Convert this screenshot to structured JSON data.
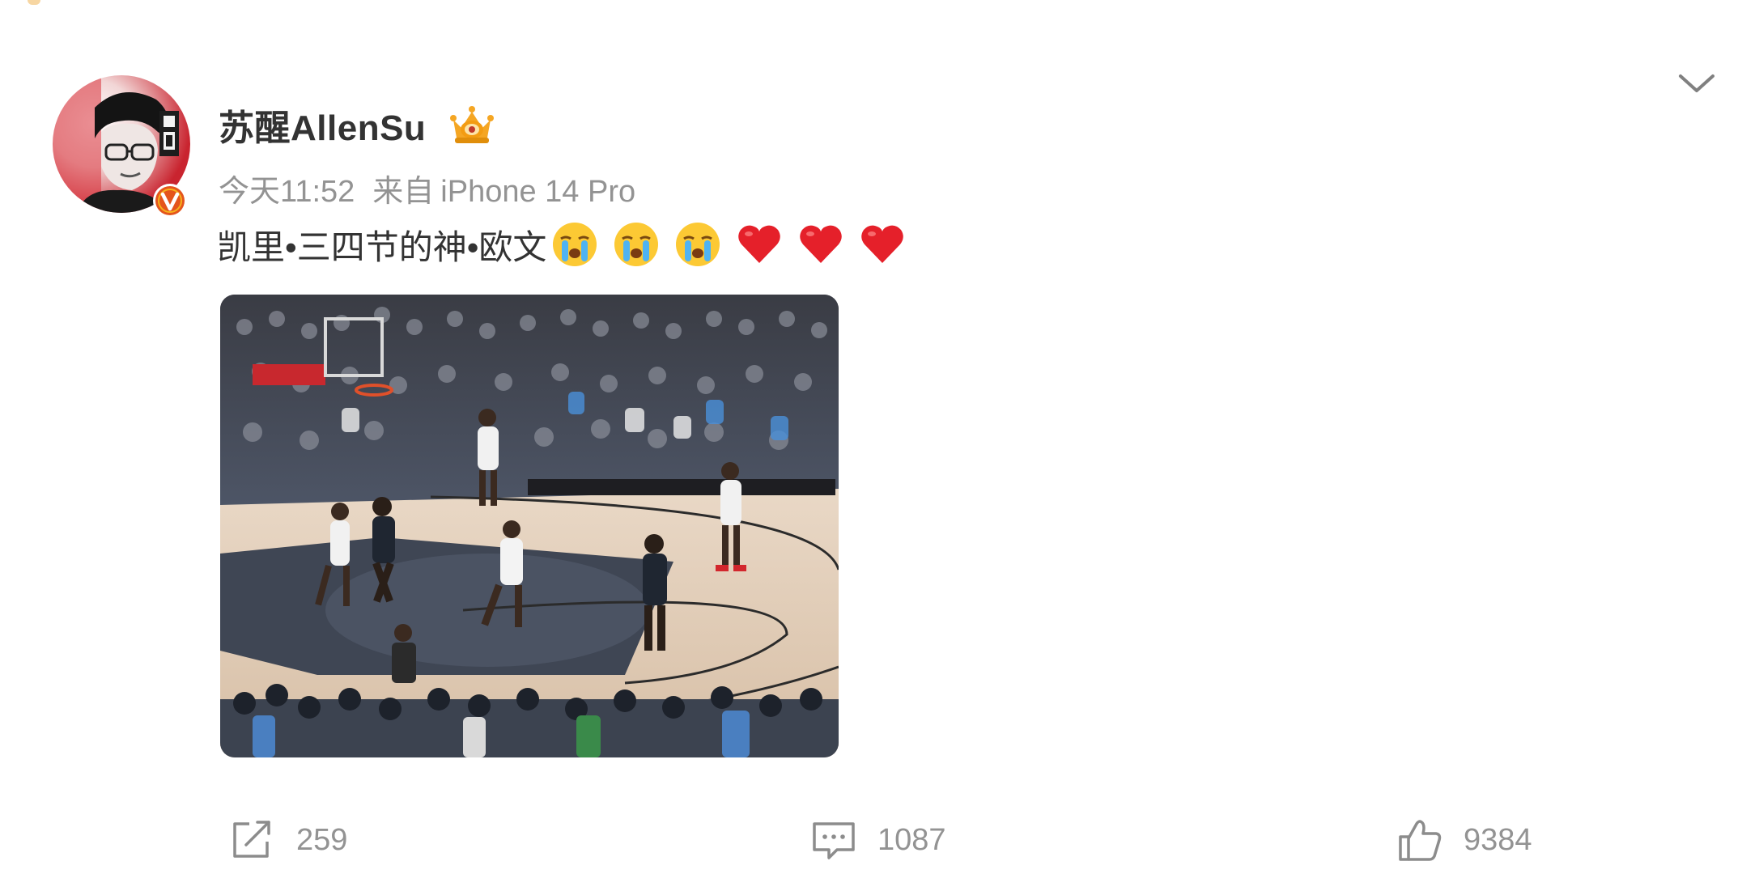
{
  "post": {
    "author": {
      "name": "苏醒AllenSu",
      "avatar_icon": "avatar-portrait-icon",
      "verified_icon": "verified-v-badge-icon",
      "badge_icon": "crown-badge-icon"
    },
    "meta": {
      "time": "今天11:52",
      "source_prefix": "来自",
      "device": "iPhone 14 Pro"
    },
    "content": {
      "text": "凯里•三四节的神•欧文",
      "emojis": [
        "crying-face-icon",
        "crying-face-icon",
        "crying-face-icon",
        "red-heart-icon",
        "red-heart-icon",
        "red-heart-icon"
      ]
    },
    "media": {
      "type": "video-thumbnail",
      "icon": "basketball-game-thumbnail"
    },
    "menu": {
      "icon": "chevron-down-icon"
    },
    "actions": {
      "repost_count": "259",
      "comment_count": "1087",
      "like_count": "9384"
    }
  },
  "colors": {
    "primary_text": "#333333",
    "secondary_text": "#939393",
    "verified_badge": "#e4551c",
    "heart": "#e5202a"
  }
}
